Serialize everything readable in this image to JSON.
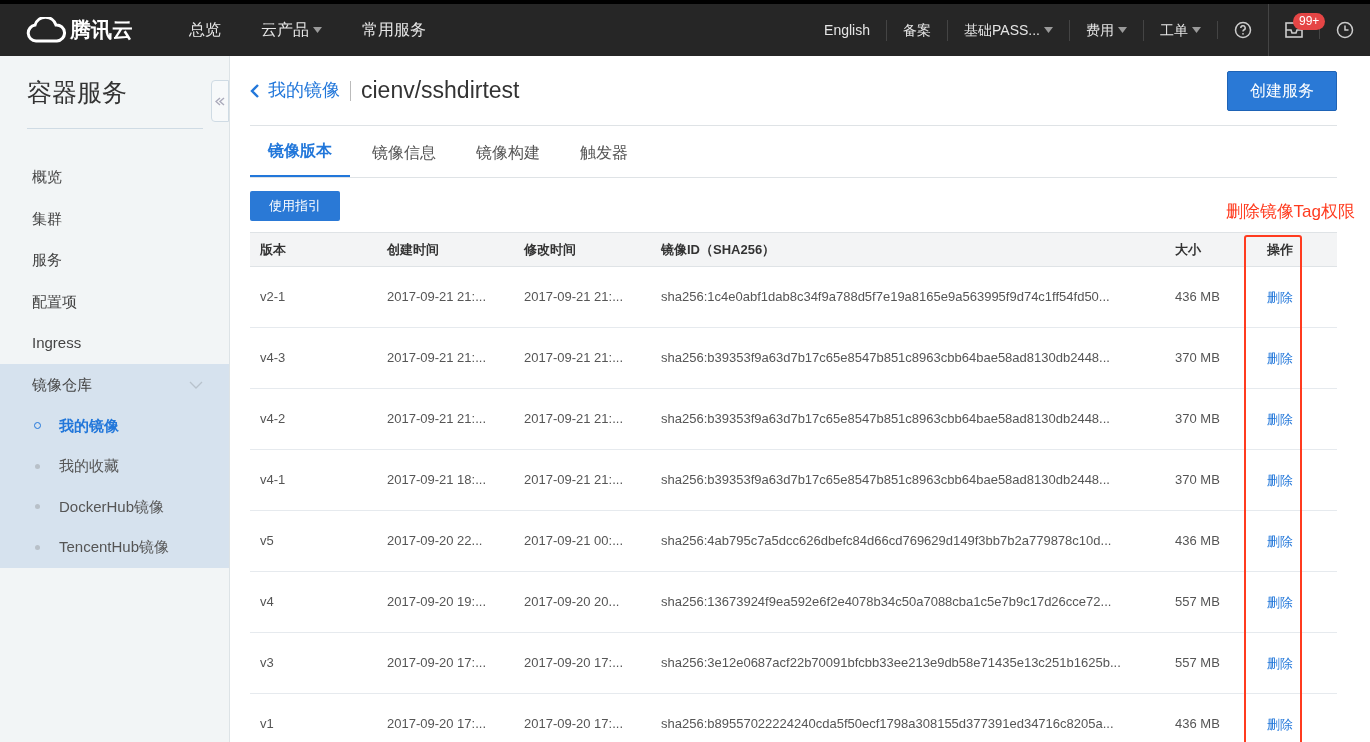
{
  "topbar": {
    "logo": "腾讯云",
    "nav": [
      {
        "label": "总览",
        "dropdown": false
      },
      {
        "label": "云产品",
        "dropdown": true
      },
      {
        "label": "常用服务",
        "dropdown": false
      }
    ],
    "right": [
      {
        "kind": "text",
        "label": "English",
        "dropdown": false
      },
      {
        "kind": "text",
        "label": "备案",
        "dropdown": false
      },
      {
        "kind": "text",
        "label": "基础PASS...",
        "dropdown": true
      },
      {
        "kind": "text",
        "label": "费用",
        "dropdown": true
      },
      {
        "kind": "text",
        "label": "工单",
        "dropdown": true
      },
      {
        "kind": "help"
      },
      {
        "kind": "inbox",
        "badge": "99+"
      },
      {
        "kind": "clock"
      }
    ]
  },
  "sidebar": {
    "title": "容器服务",
    "items": [
      {
        "label": "概览",
        "expanded": false
      },
      {
        "label": "集群",
        "expanded": false
      },
      {
        "label": "服务",
        "expanded": false
      },
      {
        "label": "配置项",
        "expanded": false
      },
      {
        "label": "Ingress",
        "expanded": false
      },
      {
        "label": "镜像仓库",
        "expanded": true,
        "children": [
          {
            "label": "我的镜像",
            "selected": true
          },
          {
            "label": "我的收藏",
            "selected": false
          },
          {
            "label": "DockerHub镜像",
            "selected": false
          },
          {
            "label": "TencentHub镜像",
            "selected": false
          }
        ]
      }
    ]
  },
  "header": {
    "back": "我的镜像",
    "title": "cienv/sshdirtest",
    "create_button": "创建服务"
  },
  "tabs": [
    {
      "label": "镜像版本",
      "selected": true
    },
    {
      "label": "镜像信息",
      "selected": false
    },
    {
      "label": "镜像构建",
      "selected": false
    },
    {
      "label": "触发器",
      "selected": false
    }
  ],
  "guide_button": "使用指引",
  "annotation": "删除镜像Tag权限",
  "table": {
    "columns": [
      "版本",
      "创建时间",
      "修改时间",
      "镜像ID（SHA256）",
      "大小",
      "操作"
    ],
    "rows": [
      {
        "version": "v2-1",
        "created": "2017-09-21 21:...",
        "modified": "2017-09-21 21:...",
        "id": "sha256:1c4e0abf1dab8c34f9a788d5f7e19a8165e9a563995f9d74c1ff54fd50...",
        "size": "436 MB",
        "action": "删除"
      },
      {
        "version": "v4-3",
        "created": "2017-09-21 21:...",
        "modified": "2017-09-21 21:...",
        "id": "sha256:b39353f9a63d7b17c65e8547b851c8963cbb64bae58ad8130db2448...",
        "size": "370 MB",
        "action": "删除"
      },
      {
        "version": "v4-2",
        "created": "2017-09-21 21:...",
        "modified": "2017-09-21 21:...",
        "id": "sha256:b39353f9a63d7b17c65e8547b851c8963cbb64bae58ad8130db2448...",
        "size": "370 MB",
        "action": "删除"
      },
      {
        "version": "v4-1",
        "created": "2017-09-21 18:...",
        "modified": "2017-09-21 21:...",
        "id": "sha256:b39353f9a63d7b17c65e8547b851c8963cbb64bae58ad8130db2448...",
        "size": "370 MB",
        "action": "删除"
      },
      {
        "version": "v5",
        "created": "2017-09-20 22...",
        "modified": "2017-09-21 00:...",
        "id": "sha256:4ab795c7a5dcc626dbefc84d66cd769629d149f3bb7b2a779878c10d...",
        "size": "436 MB",
        "action": "删除"
      },
      {
        "version": "v4",
        "created": "2017-09-20 19:...",
        "modified": "2017-09-20 20...",
        "id": "sha256:13673924f9ea592e6f2e4078b34c50a7088cba1c5e7b9c17d26cce72...",
        "size": "557 MB",
        "action": "删除"
      },
      {
        "version": "v3",
        "created": "2017-09-20 17:...",
        "modified": "2017-09-20 17:...",
        "id": "sha256:3e12e0687acf22b70091bfcbb33ee213e9db58e71435e13c251b1625b...",
        "size": "557 MB",
        "action": "删除"
      },
      {
        "version": "v1",
        "created": "2017-09-20 17:...",
        "modified": "2017-09-20 17:...",
        "id": "sha256:b89557022224240cda5f50ecf1798a308155d377391ed34716c8205a...",
        "size": "436 MB",
        "action": "删除"
      }
    ]
  }
}
